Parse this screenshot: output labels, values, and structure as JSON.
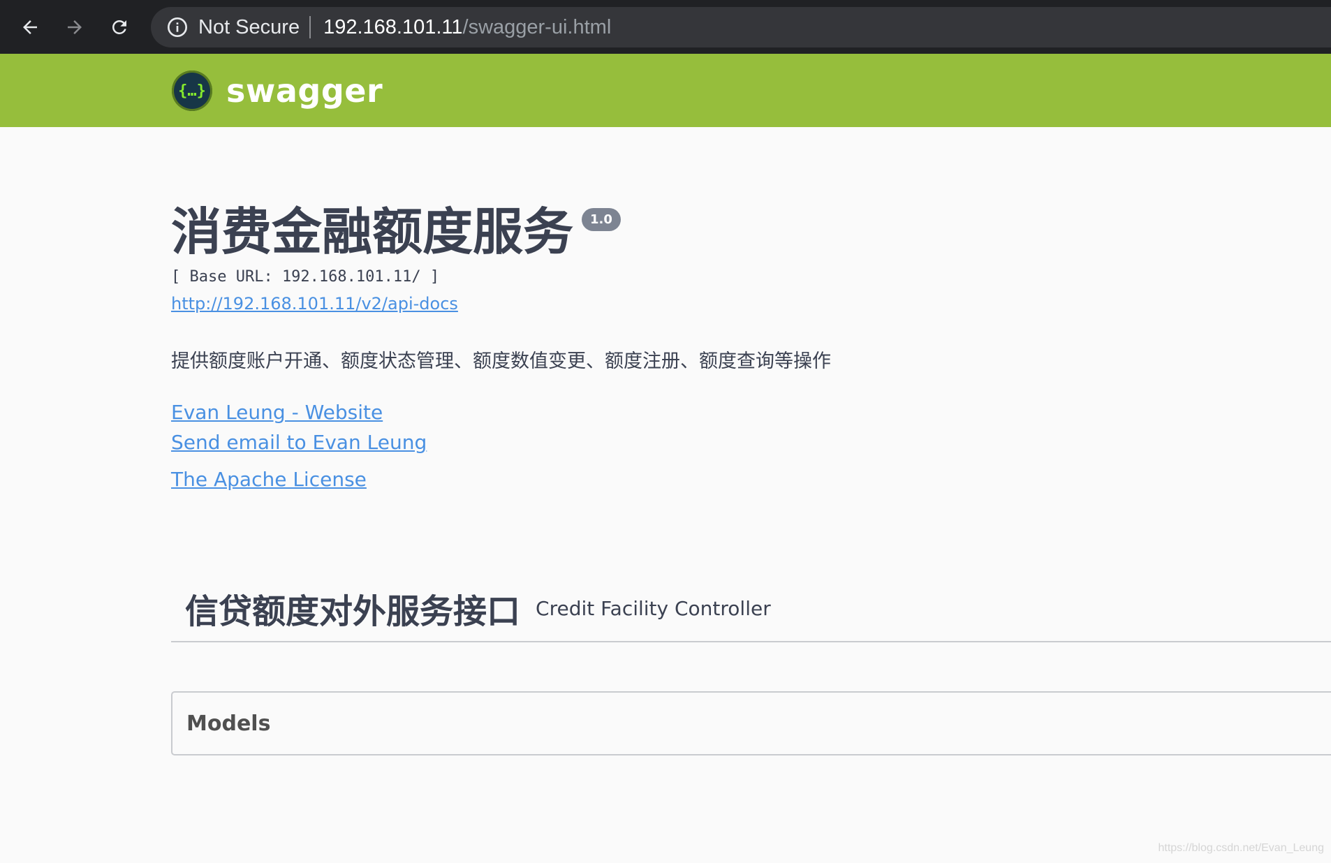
{
  "browser": {
    "security_label": "Not Secure",
    "url_host": "192.168.101.11",
    "url_path": "/swagger-ui.html"
  },
  "topbar": {
    "logo_glyph": "{…}",
    "logo_text": "swagger",
    "color": "#96be3c"
  },
  "info": {
    "title": "消费金融额度服务",
    "version": "1.0",
    "base_url": "[ Base URL: 192.168.101.11/ ]",
    "api_docs_link": "http://192.168.101.11/v2/api-docs",
    "description": "提供额度账户开通、额度状态管理、额度数值变更、额度注册、额度查询等操作",
    "contact_website": "Evan Leung - Website",
    "contact_email": "Send email to Evan Leung",
    "license": "The Apache License"
  },
  "tag": {
    "name": "信贷额度对外服务接口",
    "description": "Credit Facility Controller"
  },
  "models": {
    "title": "Models"
  },
  "watermark": "https://blog.csdn.net/Evan_Leung",
  "colors": {
    "link": "#4990e2",
    "text": "#3b4151",
    "version_badge": "#7d8492"
  },
  "icons": [
    "back-arrow-icon",
    "forward-arrow-icon",
    "reload-icon",
    "info-icon",
    "swagger-logo-icon"
  ]
}
